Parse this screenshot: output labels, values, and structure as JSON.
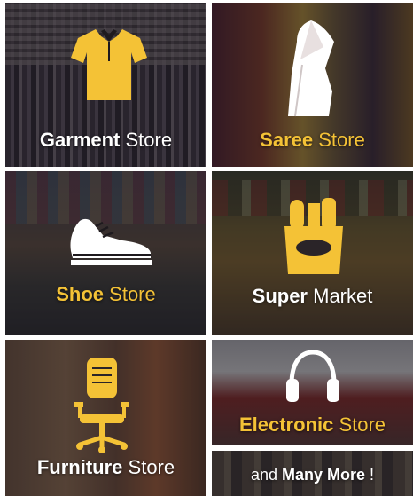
{
  "tiles": {
    "garment": {
      "bold": "Garment",
      "rest": " Store",
      "icon": "shirt-icon",
      "label_color": "#ffffff"
    },
    "saree": {
      "bold": "Saree",
      "rest": " Store",
      "icon": "saree-icon",
      "label_color": "#f4c236"
    },
    "shoe": {
      "bold": "Shoe",
      "rest": " Store",
      "icon": "shoe-icon",
      "label_color": "#f4c236"
    },
    "super": {
      "bold": "Super",
      "rest": " Market",
      "icon": "grocery-bag-icon",
      "label_color": "#ffffff"
    },
    "furniture": {
      "bold": "Furniture",
      "rest": " Store",
      "icon": "office-chair-icon",
      "label_color": "#ffffff"
    },
    "electronic": {
      "bold": "Electronic",
      "rest": " Store",
      "icon": "headphones-icon",
      "label_color": "#f4c236"
    },
    "more": {
      "pre": "and ",
      "bold": "Many More",
      "rest": " !",
      "label_color": "#ffffff"
    }
  },
  "colors": {
    "accent": "#f4c236",
    "text": "#ffffff"
  }
}
